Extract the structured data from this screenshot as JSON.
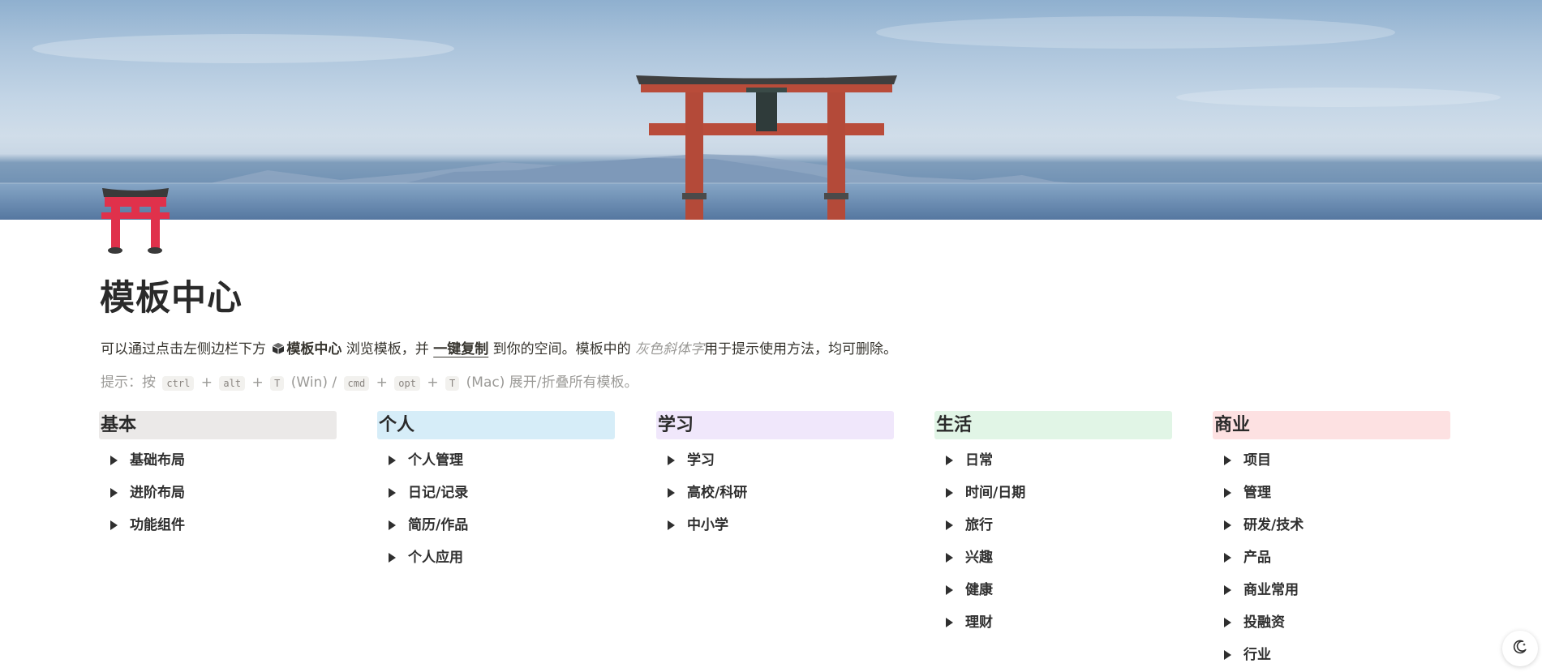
{
  "cover": {
    "description_icon": "torii-gate-seascape-image"
  },
  "page_icon": {
    "icon": "torii-icon",
    "accent": "#e0314b"
  },
  "title": "模板中心",
  "intro": {
    "part1": "可以通过点击左侧边栏下方",
    "bold": "模板中心",
    "part2": "浏览模板，并",
    "underline": "一键复制",
    "part3": "到你的空间。模板中的",
    "gray_italic": "灰色斜体字",
    "part4": "用于提示使用方法，均可删除。"
  },
  "hint": {
    "prefix": "提示：按",
    "k1": "ctrl",
    "plus1": "+",
    "k2": "alt",
    "plus2": "+",
    "k3": "T",
    "win": "(Win) /",
    "k4": "cmd",
    "plus3": "+",
    "k5": "opt",
    "plus4": "+",
    "k6": "T",
    "suffix": "(Mac) 展开/折叠所有模板。"
  },
  "columns": [
    {
      "title": "基本",
      "color": "#ebe9e8",
      "items": [
        "基础布局",
        "进阶布局",
        "功能组件"
      ]
    },
    {
      "title": "个人",
      "color": "#d6edf8",
      "items": [
        "个人管理",
        "日记/记录",
        "简历/作品",
        "个人应用"
      ]
    },
    {
      "title": "学习",
      "color": "#f0e7fb",
      "items": [
        "学习",
        "高校/科研",
        "中小学"
      ]
    },
    {
      "title": "生活",
      "color": "#e1f5e6",
      "items": [
        "日常",
        "时间/日期",
        "旅行",
        "兴趣",
        "健康",
        "理财"
      ]
    },
    {
      "title": "商业",
      "color": "#fde1e2",
      "items": [
        "项目",
        "管理",
        "研发/技术",
        "产品",
        "商业常用",
        "投融资",
        "行业"
      ]
    }
  ],
  "theme_toggle": {
    "icon": "moon-icon"
  }
}
